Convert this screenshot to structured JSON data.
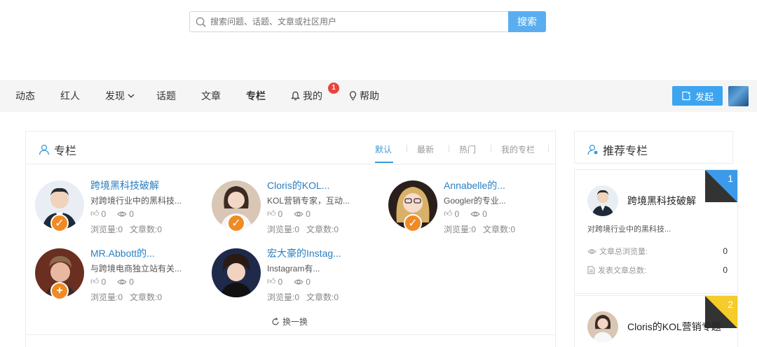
{
  "search": {
    "placeholder": "搜索问题、话题、文章或社区用户",
    "button_label": "搜索"
  },
  "nav": {
    "items": [
      {
        "label": "动态"
      },
      {
        "label": "红人"
      },
      {
        "label": "发现"
      },
      {
        "label": "话题"
      },
      {
        "label": "文章"
      },
      {
        "label": "专栏"
      },
      {
        "label": "我的"
      },
      {
        "label": "帮助"
      }
    ],
    "notification_count": "1",
    "publish_label": "发起"
  },
  "column_panel": {
    "title": "专栏",
    "tabs": [
      {
        "label": "默认"
      },
      {
        "label": "最新"
      },
      {
        "label": "热门"
      },
      {
        "label": "我的专栏"
      }
    ],
    "cards": [
      {
        "name": "跨境黑科技破解",
        "desc": "对跨境行业中的黑科技...",
        "likes": "0",
        "views": "0",
        "view_count": "浏览量:0",
        "article_count": "文章数:0",
        "badge": "check"
      },
      {
        "name": "Cloris的KOL...",
        "desc": "KOL营销专家，互动...",
        "likes": "0",
        "views": "0",
        "view_count": "浏览量:0",
        "article_count": "文章数:0",
        "badge": "check"
      },
      {
        "name": "Annabelle的...",
        "desc": "Googler的专业...",
        "likes": "0",
        "views": "0",
        "view_count": "浏览量:0",
        "article_count": "文章数:0",
        "badge": "check"
      },
      {
        "name": "MR.Abbott的...",
        "desc": "与跨境电商独立站有关...",
        "likes": "0",
        "views": "0",
        "view_count": "浏览量:0",
        "article_count": "文章数:0",
        "badge": "plus"
      },
      {
        "name": "宏大豪的Instag...",
        "desc": "Instagram有...",
        "likes": "0",
        "views": "0",
        "view_count": "浏览量:0",
        "article_count": "文章数:0",
        "badge": "none"
      }
    ],
    "refresh_label": "换一换"
  },
  "recommend": {
    "title": "推荐专栏",
    "items": [
      {
        "rank": "1",
        "name": "跨境黑科技破解",
        "desc": "对跨境行业中的黑科技...",
        "total_views_label": "文章总浏览量:",
        "total_views": "0",
        "total_articles_label": "发表文章总数:",
        "total_articles": "0",
        "color": "#3d9ae8"
      },
      {
        "rank": "2",
        "name": "Cloris的KOL营销专题",
        "color": "#f5cc2a"
      }
    ]
  }
}
